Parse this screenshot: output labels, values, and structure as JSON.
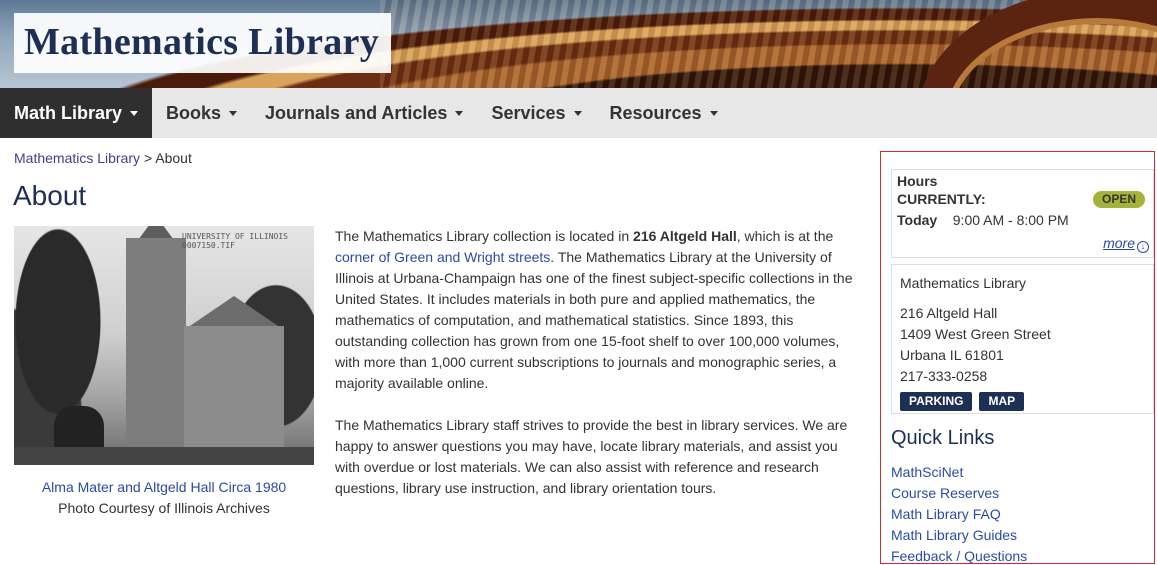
{
  "header": {
    "site_title": "Mathematics Library"
  },
  "nav": {
    "items": [
      {
        "label": "Math Library",
        "active": true
      },
      {
        "label": "Books"
      },
      {
        "label": "Journals and Articles"
      },
      {
        "label": "Services"
      },
      {
        "label": "Resources"
      }
    ]
  },
  "breadcrumb": {
    "home": "Mathematics Library",
    "separator": ">",
    "current": "About"
  },
  "page": {
    "title": "About"
  },
  "photo": {
    "stamp_line1": "UNIVERSITY OF ILLINOIS",
    "stamp_line2": "0007150.TIF",
    "caption_link": "Alma Mater and Altgeld Hall Circa 1980",
    "caption_credit": "Photo Courtesy of Illinois Archives"
  },
  "content": {
    "p1_a": "The Mathematics Library collection is located in ",
    "p1_bold": "216 Altgeld Hall",
    "p1_b": ", which is at the ",
    "p1_link": "corner of Green and Wright streets",
    "p1_c": ". The Mathematics Library at the University of Illinois at Urbana-Champaign has one of the finest subject-specific collections in the United States. It includes materials in both pure and applied mathematics, the mathematics of computation, and mathematical statistics. Since 1893, this outstanding collection has grown from one 15-foot shelf to over 100,000 volumes, with more than 1,000 current subscriptions to journals and monographic series, a majority available online.",
    "p2": "The Mathematics Library staff strives to provide the best in library services. We are happy to answer questions you may have, locate library materials, and assist you with overdue or lost materials. We can also assist with reference and research questions, library use instruction, and library orientation tours."
  },
  "hours": {
    "title": "Hours",
    "currently_label": "CURRENTLY:",
    "status": "OPEN",
    "today_label": "Today",
    "today_hours": "9:00 AM - 8:00 PM",
    "more": "more"
  },
  "address": {
    "name": "Mathematics Library",
    "line1": "216 Altgeld Hall",
    "line2": "1409 West Green Street",
    "line3": "Urbana IL 61801",
    "phone": "217-333-0258",
    "parking_btn": "PARKING",
    "map_btn": "MAP"
  },
  "quick_links": {
    "title": "Quick Links",
    "items": [
      "MathSciNet",
      "Course Reserves",
      "Math Library FAQ",
      "Math Library Guides",
      "Feedback / Questions"
    ]
  },
  "colors": {
    "brand_navy": "#1e2f55",
    "link_blue": "#2a4ba8",
    "open_green": "#a4b43a",
    "highlight_red": "#c9302c"
  }
}
